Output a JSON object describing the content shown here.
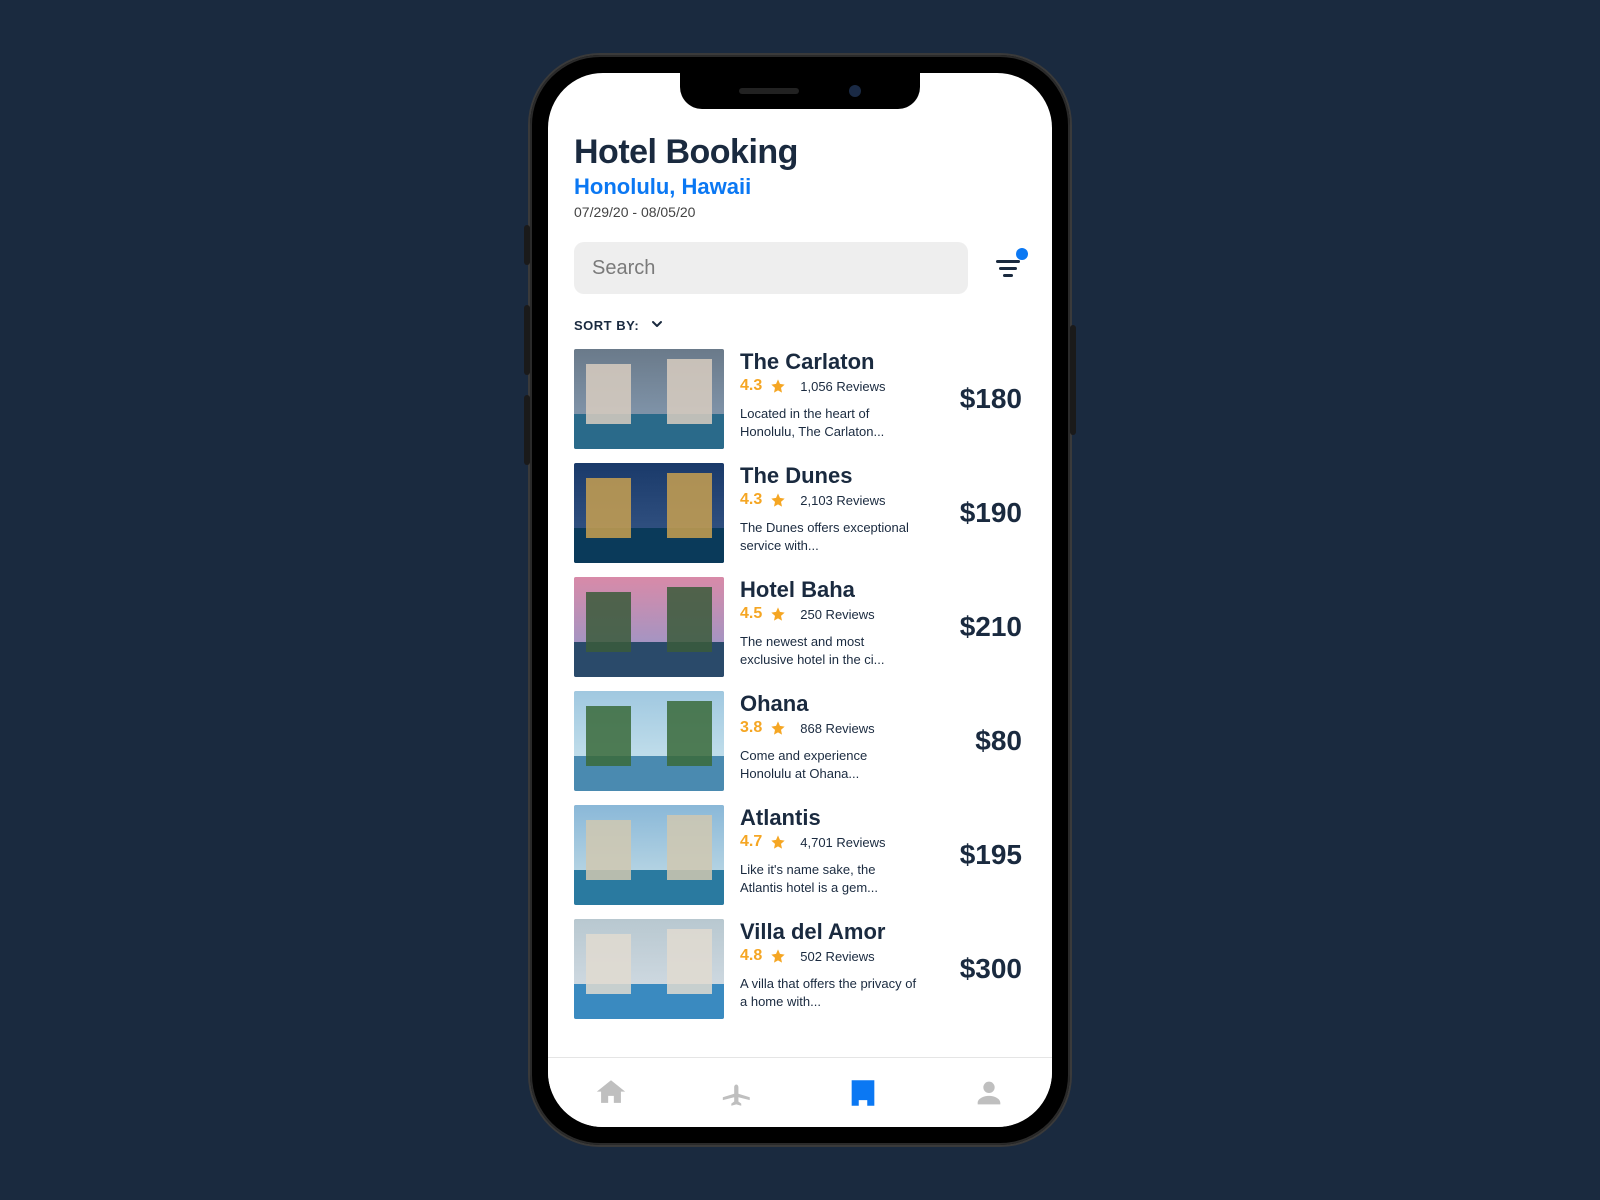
{
  "header": {
    "title": "Hotel Booking",
    "location": "Honolulu, Hawaii",
    "dates": "07/29/20 - 08/05/20"
  },
  "search": {
    "placeholder": "Search",
    "value": ""
  },
  "sort": {
    "label": "SORT BY:"
  },
  "hotels": [
    {
      "name": "The Carlaton",
      "rating": "4.3",
      "reviews": "1,056 Reviews",
      "desc": "Located in the heart of Honolulu, The Carlaton...",
      "price": "$180"
    },
    {
      "name": "The Dunes",
      "rating": "4.3",
      "reviews": "2,103 Reviews",
      "desc": "The Dunes offers exceptional service with...",
      "price": "$190"
    },
    {
      "name": "Hotel Baha",
      "rating": "4.5",
      "reviews": "250 Reviews",
      "desc": "The newest and most exclusive hotel in the ci...",
      "price": "$210"
    },
    {
      "name": "Ohana",
      "rating": "3.8",
      "reviews": "868 Reviews",
      "desc": "Come and experience Honolulu at Ohana...",
      "price": "$80"
    },
    {
      "name": "Atlantis",
      "rating": "4.7",
      "reviews": "4,701 Reviews",
      "desc": "Like it's name sake, the Atlantis hotel is a gem...",
      "price": "$195"
    },
    {
      "name": "Villa del Amor",
      "rating": "4.8",
      "reviews": "502 Reviews",
      "desc": "A villa that offers the privacy of a home with...",
      "price": "$300"
    }
  ],
  "tabs": {
    "home": "home",
    "flights": "flights",
    "hotels": "hotels",
    "profile": "profile",
    "active": "hotels"
  },
  "thumbs": [
    {
      "sky": "linear-gradient(#6a7a8a,#8aa0b8)",
      "water": "#2a6a8a",
      "bldg": "#d8cdbf"
    },
    {
      "sky": "linear-gradient(#1a3a6a,#3a5a8a)",
      "water": "#0a3a5a",
      "bldg": "#c8a050"
    },
    {
      "sky": "linear-gradient(#d88aa8,#8a9ad0)",
      "water": "#2a4a6a",
      "bldg": "#3a5a3a"
    },
    {
      "sky": "linear-gradient(#a0c8e0,#d0e8f0)",
      "water": "#4a8ab0",
      "bldg": "#3a6a3a"
    },
    {
      "sky": "linear-gradient(#8ab8d8,#c8e0e8)",
      "water": "#2a7aa0",
      "bldg": "#d0c8b0"
    },
    {
      "sky": "linear-gradient(#b8c8d0,#d8e0e8)",
      "water": "#3a8ac0",
      "bldg": "#e0dad0"
    }
  ]
}
